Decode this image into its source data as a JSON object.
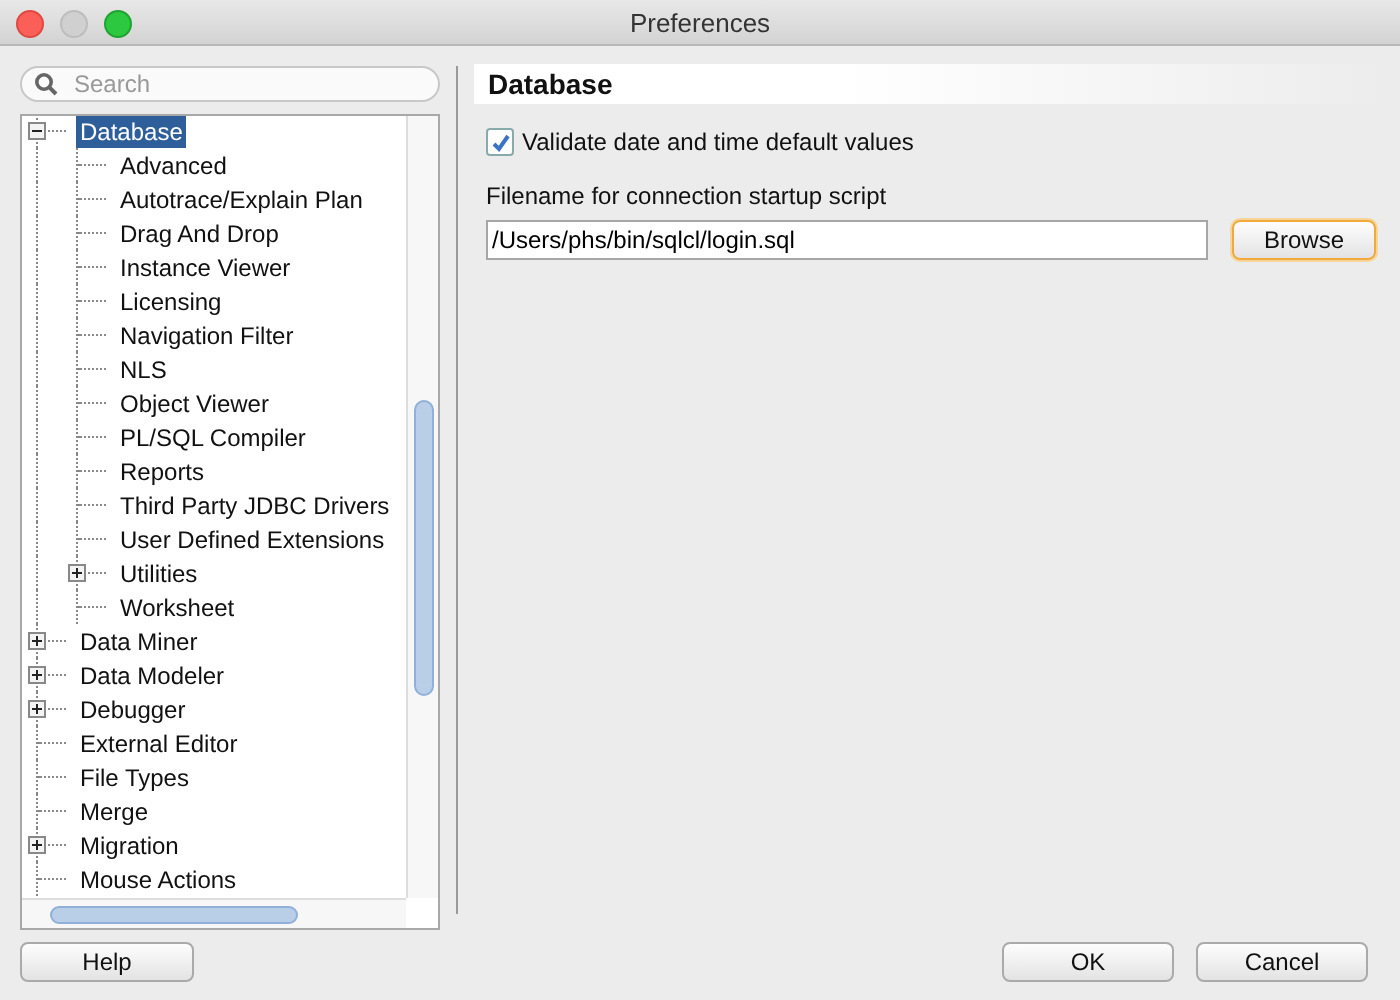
{
  "window": {
    "title": "Preferences"
  },
  "search": {
    "placeholder": "Search"
  },
  "tree": [
    {
      "label": "Database",
      "selected": true,
      "expanded": true,
      "children": [
        {
          "label": "Advanced",
          "selected": false
        },
        {
          "label": "Autotrace/Explain Plan",
          "selected": false
        },
        {
          "label": "Drag And Drop",
          "selected": false
        },
        {
          "label": "Instance Viewer",
          "selected": false
        },
        {
          "label": "Licensing",
          "selected": false
        },
        {
          "label": "Navigation Filter",
          "selected": false
        },
        {
          "label": "NLS",
          "selected": false
        },
        {
          "label": "Object Viewer",
          "selected": false
        },
        {
          "label": "PL/SQL Compiler",
          "selected": false
        },
        {
          "label": "Reports",
          "selected": false
        },
        {
          "label": "Third Party JDBC Drivers",
          "selected": false
        },
        {
          "label": "User Defined Extensions",
          "selected": false
        },
        {
          "label": "Utilities",
          "selected": false,
          "expanded": false
        },
        {
          "label": "Worksheet",
          "selected": false
        }
      ]
    },
    {
      "label": "Data Miner",
      "selected": false,
      "expanded": false
    },
    {
      "label": "Data Modeler",
      "selected": false,
      "expanded": false
    },
    {
      "label": "Debugger",
      "selected": false,
      "expanded": false
    },
    {
      "label": "External Editor",
      "selected": false
    },
    {
      "label": "File Types",
      "selected": false
    },
    {
      "label": "Merge",
      "selected": false
    },
    {
      "label": "Migration",
      "selected": false,
      "expanded": false
    },
    {
      "label": "Mouse Actions",
      "selected": false
    }
  ],
  "panel": {
    "title": "Database",
    "checkbox": {
      "label": "Validate date and time default values",
      "checked": true
    },
    "field": {
      "label": "Filename for connection startup script",
      "value": "/Users/phs/bin/sqlcl/login.sql"
    },
    "browse_button": "Browse"
  },
  "buttons": {
    "help": "Help",
    "ok": "OK",
    "cancel": "Cancel"
  }
}
